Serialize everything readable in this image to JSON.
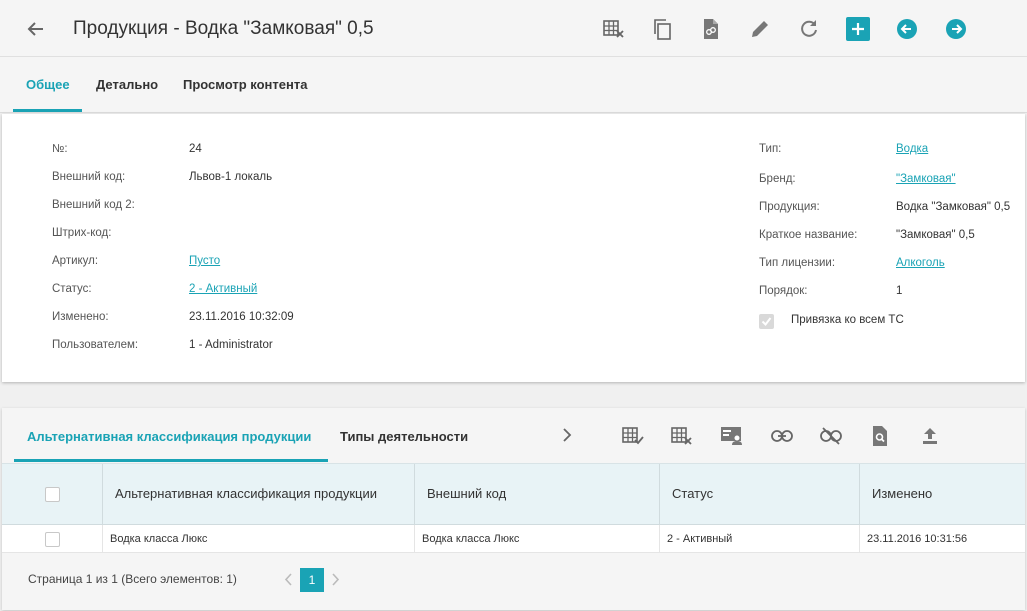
{
  "header": {
    "title": "Продукция - Водка \"Замковая\" 0,5",
    "toolbar_icons": [
      "table-remove-icon",
      "copy-icon",
      "file-link-icon",
      "edit-pencil-icon",
      "refresh-icon",
      "add-plus-icon",
      "arrow-left-circle-icon",
      "arrow-right-circle-icon"
    ]
  },
  "tabs": [
    {
      "label": "Общее",
      "active": true
    },
    {
      "label": "Детально",
      "active": false
    },
    {
      "label": "Просмотр контента",
      "active": false
    }
  ],
  "details": {
    "left": [
      {
        "label": "№:",
        "value": "24",
        "link": false
      },
      {
        "label": "Внешний код:",
        "value": "Львов-1 локаль",
        "link": false
      },
      {
        "label": "Внешний код 2:",
        "value": "",
        "link": false
      },
      {
        "label": "Штрих-код:",
        "value": "",
        "link": false
      },
      {
        "label": "Артикул:",
        "value": "Пусто",
        "link": true
      },
      {
        "label": "Статус:",
        "value": "2 - Активный",
        "link": true
      },
      {
        "label": "Изменено:",
        "value": "23.11.2016 10:32:09",
        "link": false
      },
      {
        "label": "Пользователем:",
        "value": "1 - Administrator",
        "link": false
      }
    ],
    "right": [
      {
        "label": "Тип:",
        "value": "Водка",
        "link": true
      },
      {
        "label": "Бренд:",
        "value": "\"Замковая\"",
        "link": true
      },
      {
        "label": "Продукция:",
        "value": "Водка \"Замковая\" 0,5",
        "link": false
      },
      {
        "label": "Краткое название:",
        "value": "\"Замковая\" 0,5",
        "link": false
      },
      {
        "label": "Тип лицензии:",
        "value": "Алкоголь",
        "link": true
      },
      {
        "label": "Порядок:",
        "value": "1",
        "link": false
      }
    ],
    "checkbox_label": "Привязка ко всем ТС",
    "checkbox_checked": true
  },
  "subtabs": [
    {
      "label": "Альтернативная классификация продукции",
      "active": true
    },
    {
      "label": "Типы деятельности",
      "active": false
    }
  ],
  "table": {
    "columns": [
      "Альтернативная классификация продукции",
      "Внешний код",
      "Статус",
      "Изменено"
    ],
    "rows": [
      [
        "Водка класса Люкс",
        "Водка класса Люкс",
        "2 - Активный",
        "23.11.2016 10:31:56"
      ]
    ]
  },
  "pager": {
    "text": "Страница 1 из 1 (Всего элементов: 1)",
    "current_page": "1"
  },
  "colors": {
    "accent": "#1aa3b5",
    "header_bg": "#f5f5f5",
    "table_header_bg": "#e8f3f6"
  }
}
